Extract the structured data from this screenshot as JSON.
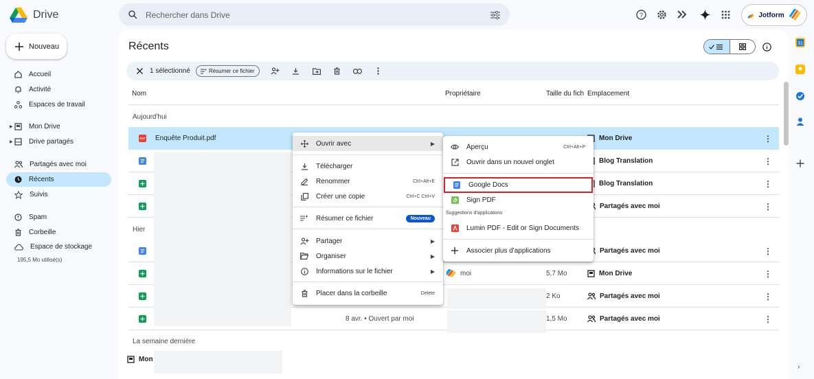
{
  "app": {
    "name": "Drive"
  },
  "search": {
    "placeholder": "Rechercher dans Drive"
  },
  "jotform": {
    "label": "Jotform"
  },
  "sidebar": {
    "new_label": "Nouveau",
    "items": [
      {
        "label": "Accueil",
        "icon": "home-icon"
      },
      {
        "label": "Activité",
        "icon": "bell-icon"
      },
      {
        "label": "Espaces de travail",
        "icon": "workspaces-icon"
      },
      {
        "label": "Mon Drive",
        "icon": "my-drive-icon"
      },
      {
        "label": "Drive partagés",
        "icon": "shared-drives-icon"
      },
      {
        "label": "Partagés avec moi",
        "icon": "people-icon"
      },
      {
        "label": "Récents",
        "icon": "clock-icon"
      },
      {
        "label": "Suivis",
        "icon": "star-icon"
      },
      {
        "label": "Spam",
        "icon": "spam-icon"
      },
      {
        "label": "Corbeille",
        "icon": "trash-icon"
      },
      {
        "label": "Espace de stockage",
        "icon": "cloud-icon"
      }
    ],
    "storage_used": "195,5 Mo utilisé(s)"
  },
  "main": {
    "title": "Récents",
    "selection": {
      "count_label": "1 sélectionné",
      "summarize_label": "Résumer ce fichier"
    },
    "columns": {
      "name": "Nom",
      "owner": "Propriétaire",
      "size": "Taille du fich",
      "location": "Emplacement"
    },
    "groups": {
      "today": "Aujourd'hui",
      "yesterday": "Hier",
      "last_week": "La semaine dernière"
    },
    "rows": [
      {
        "name": "Enquête Produit.pdf",
        "location": "Mon Drive"
      },
      {
        "location": "Blog Translation"
      },
      {
        "location": "Blog Translation"
      },
      {
        "location": "Partagés avec moi"
      },
      {
        "location": "Partagés avec moi"
      },
      {
        "owner": "moi",
        "size": "5,7 Mo",
        "location": "Mon Drive"
      },
      {
        "size": "2 Ko",
        "location": "Partagés avec moi"
      },
      {
        "opened": "8 avr. • Ouvert par moi",
        "size": "1,5 Mo",
        "location": "Partagés avec moi"
      }
    ],
    "last_week_row": {
      "location": "Mon"
    }
  },
  "context_menu": {
    "open_with": "Ouvrir avec",
    "download": "Télécharger",
    "rename": "Renommer",
    "rename_shortcut": "Ctrl+Alt+E",
    "copy": "Créer une copie",
    "copy_shortcut": "Ctrl+C Ctrl+V",
    "summarize": "Résumer ce fichier",
    "new_badge": "Nouveau",
    "share": "Partager",
    "organize": "Organiser",
    "file_info": "Informations sur le fichier",
    "trash": "Placer dans la corbeille",
    "trash_shortcut": "Delete"
  },
  "submenu": {
    "preview": "Aperçu",
    "preview_shortcut": "Ctrl+Alt+P",
    "new_tab": "Ouvrir dans un nouvel onglet",
    "google_docs": "Google Docs",
    "sign_pdf": "Sign PDF",
    "suggestions": "Suggestions d'applications",
    "lumin": "Lumin PDF - Edit or Sign Documents",
    "more_apps": "Associer plus d'applications"
  }
}
